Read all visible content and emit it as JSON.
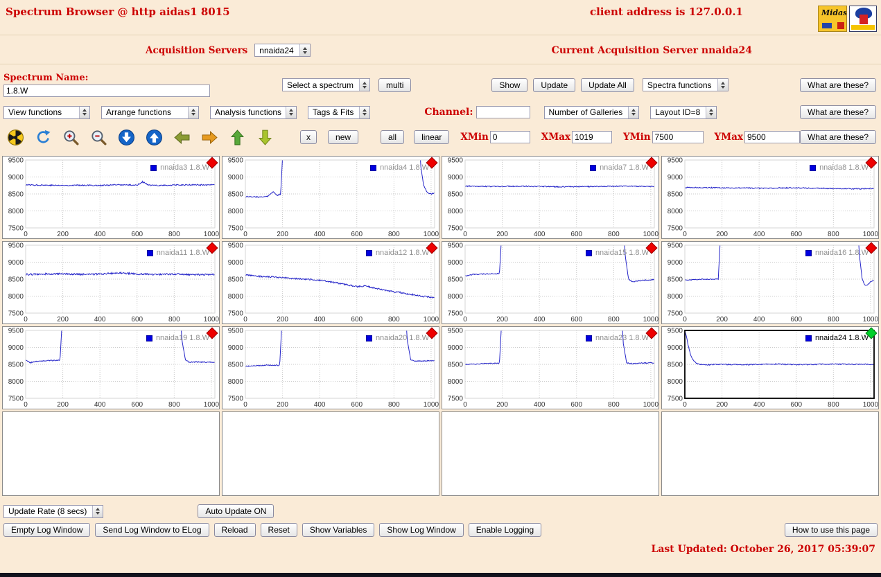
{
  "header": {
    "title": "Spectrum Browser @ http aidas1 8015",
    "client_address": "client address is 127.0.0.1",
    "midas_logo_text": "Midas"
  },
  "server_row": {
    "acquisition_servers_label": "Acquisition Servers",
    "acquisition_server_selected": "nnaida24",
    "current_server_text": "Current Acquisition Server nnaida24"
  },
  "spectrum_row": {
    "spectrum_name_label": "Spectrum Name:",
    "spectrum_name_value": "1.8.W",
    "select_spectrum_label": "Select a spectrum",
    "multi_button": "multi",
    "show_button": "Show",
    "update_button": "Update",
    "update_all_button": "Update All",
    "spectra_functions_label": "Spectra functions",
    "what_button": "What are these?"
  },
  "functions_row": {
    "view_functions_label": "View functions",
    "arrange_functions_label": "Arrange functions",
    "analysis_functions_label": "Analysis functions",
    "tags_fits_label": "Tags & Fits",
    "channel_label": "Channel:",
    "channel_value": "",
    "galleries_label": "Number of Galleries",
    "layout_label": "Layout ID=8",
    "what_button": "What are these?"
  },
  "toolbar": {
    "icons": [
      "radiation",
      "refresh",
      "zoom-in",
      "zoom-out",
      "scroll-down",
      "scroll-up",
      "pan-left",
      "pan-right",
      "pan-up",
      "pan-down"
    ],
    "x_button": "x",
    "new_button": "new",
    "all_button": "all",
    "linear_button": "linear",
    "xmin_label": "XMin",
    "xmin_value": "0",
    "xmax_label": "XMax",
    "xmax_value": "1019",
    "ymin_label": "YMin",
    "ymin_value": "7500",
    "ymax_label": "YMax",
    "ymax_value": "9500",
    "what_button": "What are these?"
  },
  "footer": {
    "update_rate_label": "Update Rate (8 secs)",
    "auto_update_button": "Auto Update ON",
    "buttons": [
      "Empty Log Window",
      "Send Log Window to ELog",
      "Reload",
      "Reset",
      "Show Variables",
      "Show Log Window",
      "Enable Logging"
    ],
    "how_to_button": "How to use this page",
    "last_updated": "Last Updated: October 26, 2017 05:39:07"
  },
  "chart_data": {
    "type": "line",
    "xlim": [
      0,
      1019
    ],
    "ylim": [
      7500,
      9500
    ],
    "xticks": [
      0,
      200,
      400,
      600,
      800,
      1000
    ],
    "yticks": [
      9500,
      9000,
      8500,
      8000,
      7500
    ],
    "line_color": "#2424c8",
    "marker_color_normal": "#ee0000",
    "marker_color_selected": "#00d02a",
    "empty_cells": 4,
    "charts": [
      {
        "name": "nnaida3 1.8.W",
        "selected": false,
        "noise": 18,
        "points": [
          [
            0,
            8770
          ],
          [
            100,
            8760
          ],
          [
            200,
            8750
          ],
          [
            300,
            8760
          ],
          [
            400,
            8750
          ],
          [
            500,
            8770
          ],
          [
            600,
            8760
          ],
          [
            630,
            8860
          ],
          [
            660,
            8760
          ],
          [
            700,
            8750
          ],
          [
            800,
            8760
          ],
          [
            900,
            8770
          ],
          [
            1019,
            8760
          ]
        ]
      },
      {
        "name": "nnaida4 1.8.W",
        "selected": false,
        "noise": 15,
        "points": [
          [
            0,
            8420
          ],
          [
            80,
            8410
          ],
          [
            120,
            8430
          ],
          [
            150,
            8560
          ],
          [
            170,
            8450
          ],
          [
            190,
            8500
          ],
          [
            210,
            10600
          ],
          [
            930,
            10600
          ],
          [
            945,
            9300
          ],
          [
            960,
            8750
          ],
          [
            980,
            8540
          ],
          [
            1000,
            8500
          ],
          [
            1019,
            8530
          ]
        ]
      },
      {
        "name": "nnaida7 1.8.W",
        "selected": false,
        "noise": 15,
        "points": [
          [
            0,
            8730
          ],
          [
            150,
            8720
          ],
          [
            300,
            8730
          ],
          [
            500,
            8710
          ],
          [
            700,
            8720
          ],
          [
            850,
            8730
          ],
          [
            1019,
            8720
          ]
        ]
      },
      {
        "name": "nnaida8 1.8.W",
        "selected": false,
        "noise": 15,
        "points": [
          [
            0,
            8690
          ],
          [
            200,
            8680
          ],
          [
            400,
            8670
          ],
          [
            600,
            8680
          ],
          [
            800,
            8660
          ],
          [
            950,
            8650
          ],
          [
            1019,
            8660
          ]
        ]
      },
      {
        "name": "nnaida11 1.8.W",
        "selected": false,
        "noise": 25,
        "points": [
          [
            0,
            8640
          ],
          [
            100,
            8650
          ],
          [
            200,
            8660
          ],
          [
            300,
            8640
          ],
          [
            400,
            8650
          ],
          [
            500,
            8690
          ],
          [
            600,
            8650
          ],
          [
            700,
            8640
          ],
          [
            800,
            8650
          ],
          [
            900,
            8630
          ],
          [
            1019,
            8640
          ]
        ]
      },
      {
        "name": "nnaida12 1.8.W",
        "selected": false,
        "noise": 22,
        "points": [
          [
            0,
            8620
          ],
          [
            80,
            8580
          ],
          [
            160,
            8560
          ],
          [
            240,
            8530
          ],
          [
            320,
            8500
          ],
          [
            400,
            8470
          ],
          [
            450,
            8430
          ],
          [
            500,
            8380
          ],
          [
            550,
            8330
          ],
          [
            600,
            8280
          ],
          [
            640,
            8300
          ],
          [
            680,
            8260
          ],
          [
            720,
            8210
          ],
          [
            760,
            8160
          ],
          [
            800,
            8130
          ],
          [
            840,
            8100
          ],
          [
            880,
            8060
          ],
          [
            920,
            8030
          ],
          [
            960,
            7990
          ],
          [
            1019,
            7960
          ]
        ]
      },
      {
        "name": "nnaida15 1.8.W",
        "selected": false,
        "noise": 14,
        "points": [
          [
            0,
            8590
          ],
          [
            40,
            8640
          ],
          [
            100,
            8650
          ],
          [
            150,
            8660
          ],
          [
            185,
            8660
          ],
          [
            205,
            10600
          ],
          [
            845,
            10600
          ],
          [
            862,
            9200
          ],
          [
            880,
            8500
          ],
          [
            900,
            8420
          ],
          [
            930,
            8450
          ],
          [
            970,
            8470
          ],
          [
            1019,
            8490
          ]
        ]
      },
      {
        "name": "nnaida16 1.8.W",
        "selected": false,
        "noise": 12,
        "points": [
          [
            0,
            8470
          ],
          [
            60,
            8490
          ],
          [
            120,
            8500
          ],
          [
            180,
            8500
          ],
          [
            200,
            10600
          ],
          [
            925,
            10600
          ],
          [
            940,
            9200
          ],
          [
            955,
            8500
          ],
          [
            970,
            8310
          ],
          [
            985,
            8340
          ],
          [
            1000,
            8420
          ],
          [
            1019,
            8480
          ]
        ]
      },
      {
        "name": "nnaida19 1.8.W",
        "selected": false,
        "noise": 14,
        "points": [
          [
            0,
            8620
          ],
          [
            25,
            8550
          ],
          [
            60,
            8590
          ],
          [
            120,
            8610
          ],
          [
            185,
            8620
          ],
          [
            205,
            10600
          ],
          [
            825,
            10600
          ],
          [
            842,
            9200
          ],
          [
            860,
            8640
          ],
          [
            880,
            8560
          ],
          [
            920,
            8570
          ],
          [
            1019,
            8560
          ]
        ]
      },
      {
        "name": "nnaida20 1.8.W",
        "selected": false,
        "noise": 13,
        "points": [
          [
            0,
            8440
          ],
          [
            60,
            8460
          ],
          [
            120,
            8480
          ],
          [
            185,
            8470
          ],
          [
            205,
            10600
          ],
          [
            855,
            10600
          ],
          [
            872,
            9200
          ],
          [
            890,
            8640
          ],
          [
            910,
            8590
          ],
          [
            950,
            8600
          ],
          [
            1019,
            8610
          ]
        ]
      },
      {
        "name": "nnaida23 1.8.W",
        "selected": false,
        "noise": 13,
        "points": [
          [
            0,
            8500
          ],
          [
            60,
            8510
          ],
          [
            120,
            8530
          ],
          [
            185,
            8530
          ],
          [
            205,
            10600
          ],
          [
            835,
            10600
          ],
          [
            852,
            9100
          ],
          [
            870,
            8540
          ],
          [
            900,
            8520
          ],
          [
            950,
            8540
          ],
          [
            1019,
            8540
          ]
        ]
      },
      {
        "name": "nnaida24 1.8.W",
        "selected": true,
        "noise": 16,
        "points": [
          [
            0,
            9500
          ],
          [
            8,
            9350
          ],
          [
            18,
            9050
          ],
          [
            30,
            8800
          ],
          [
            45,
            8620
          ],
          [
            60,
            8540
          ],
          [
            80,
            8500
          ],
          [
            120,
            8490
          ],
          [
            200,
            8500
          ],
          [
            300,
            8490
          ],
          [
            400,
            8500
          ],
          [
            500,
            8510
          ],
          [
            600,
            8490
          ],
          [
            700,
            8500
          ],
          [
            800,
            8510
          ],
          [
            900,
            8500
          ],
          [
            1019,
            8500
          ]
        ]
      }
    ]
  }
}
